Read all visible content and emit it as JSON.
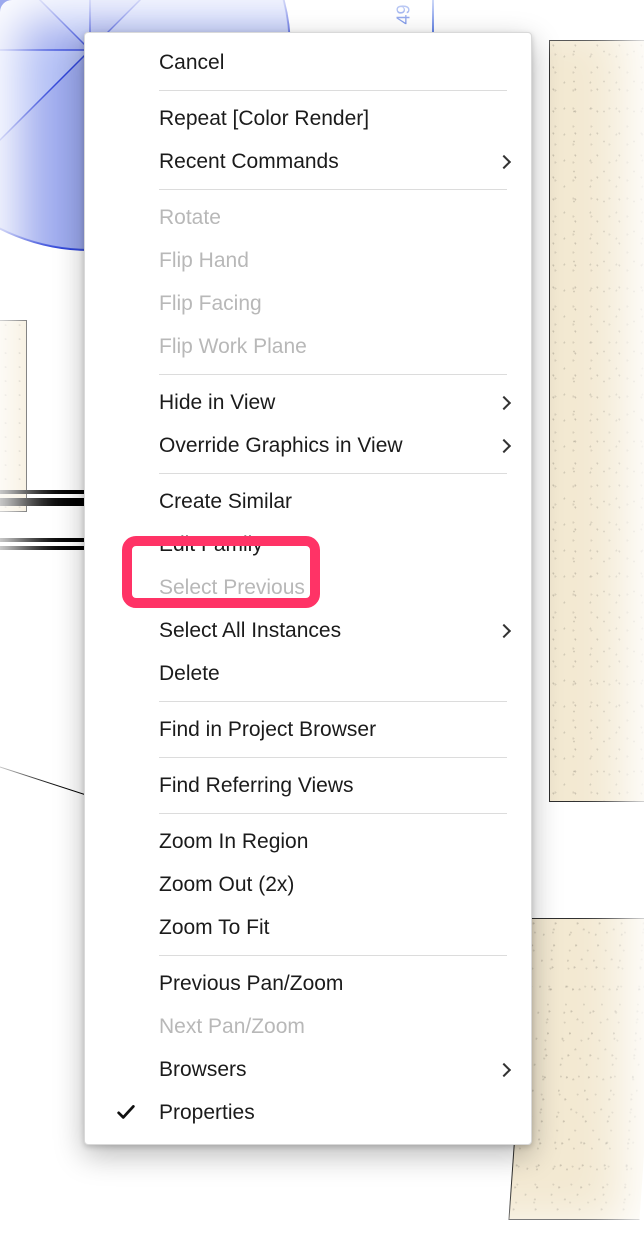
{
  "dimension_label": "49",
  "highlight_target": "edit-family",
  "menu": {
    "groups": [
      [
        {
          "id": "cancel",
          "label": "Cancel",
          "enabled": true,
          "submenu": false,
          "checked": false
        }
      ],
      [
        {
          "id": "repeat",
          "label": "Repeat [Color Render]",
          "enabled": true,
          "submenu": false,
          "checked": false
        },
        {
          "id": "recent-commands",
          "label": "Recent Commands",
          "enabled": true,
          "submenu": true,
          "checked": false
        }
      ],
      [
        {
          "id": "rotate",
          "label": "Rotate",
          "enabled": false,
          "submenu": false,
          "checked": false
        },
        {
          "id": "flip-hand",
          "label": "Flip Hand",
          "enabled": false,
          "submenu": false,
          "checked": false
        },
        {
          "id": "flip-facing",
          "label": "Flip Facing",
          "enabled": false,
          "submenu": false,
          "checked": false
        },
        {
          "id": "flip-work-plane",
          "label": "Flip Work Plane",
          "enabled": false,
          "submenu": false,
          "checked": false
        }
      ],
      [
        {
          "id": "hide-in-view",
          "label": "Hide in View",
          "enabled": true,
          "submenu": true,
          "checked": false
        },
        {
          "id": "override-graphics",
          "label": "Override Graphics in View",
          "enabled": true,
          "submenu": true,
          "checked": false
        }
      ],
      [
        {
          "id": "create-similar",
          "label": "Create Similar",
          "enabled": true,
          "submenu": false,
          "checked": false
        },
        {
          "id": "edit-family",
          "label": "Edit Family",
          "enabled": true,
          "submenu": false,
          "checked": false
        },
        {
          "id": "select-previous",
          "label": "Select Previous",
          "enabled": false,
          "submenu": false,
          "checked": false
        },
        {
          "id": "select-all-instances",
          "label": "Select All Instances",
          "enabled": true,
          "submenu": true,
          "checked": false
        },
        {
          "id": "delete",
          "label": "Delete",
          "enabled": true,
          "submenu": false,
          "checked": false
        }
      ],
      [
        {
          "id": "find-in-browser",
          "label": "Find in Project Browser",
          "enabled": true,
          "submenu": false,
          "checked": false
        }
      ],
      [
        {
          "id": "find-referring",
          "label": "Find Referring Views",
          "enabled": true,
          "submenu": false,
          "checked": false
        }
      ],
      [
        {
          "id": "zoom-in-region",
          "label": "Zoom In Region",
          "enabled": true,
          "submenu": false,
          "checked": false
        },
        {
          "id": "zoom-out-2x",
          "label": "Zoom Out (2x)",
          "enabled": true,
          "submenu": false,
          "checked": false
        },
        {
          "id": "zoom-to-fit",
          "label": "Zoom To Fit",
          "enabled": true,
          "submenu": false,
          "checked": false
        }
      ],
      [
        {
          "id": "previous-pan-zoom",
          "label": "Previous Pan/Zoom",
          "enabled": true,
          "submenu": false,
          "checked": false
        },
        {
          "id": "next-pan-zoom",
          "label": "Next Pan/Zoom",
          "enabled": false,
          "submenu": false,
          "checked": false
        },
        {
          "id": "browsers",
          "label": "Browsers",
          "enabled": true,
          "submenu": true,
          "checked": false
        },
        {
          "id": "properties",
          "label": "Properties",
          "enabled": true,
          "submenu": false,
          "checked": true
        }
      ]
    ]
  }
}
